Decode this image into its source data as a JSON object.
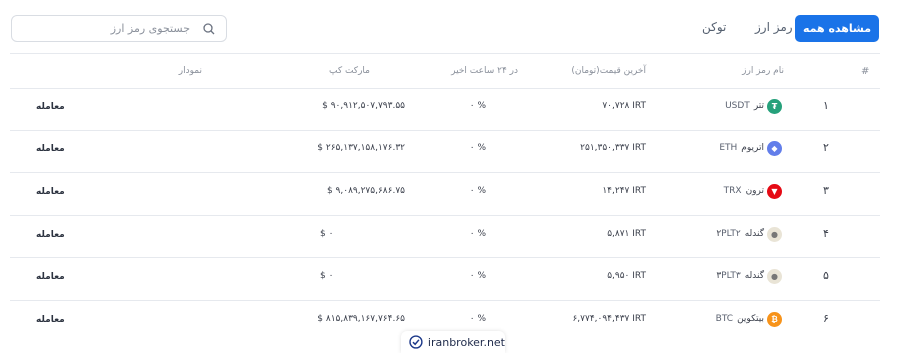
{
  "search": {
    "placeholder": "جستجوی رمز ارز"
  },
  "tabs": {
    "all": "مشاهده همه",
    "crypto": "رمز ارز",
    "token": "توکن"
  },
  "table": {
    "headers": {
      "index": "#",
      "name": "نام رمز ارز",
      "price": "آخرین قیمت(تومان)",
      "change": "در ۲۴ ساعت اخیر",
      "market_cap": "مارکت کپ",
      "chart": "نمودار"
    },
    "rows": [
      {
        "index": "۱",
        "name": "تتر",
        "symbol": "USDT",
        "icon_color": "#26a17b",
        "icon": "tether-icon",
        "price": "۷۰,۷۲۸ IRT",
        "change": "۰ %",
        "market_cap": "$ ۹۰,۹۱۲,۵۰۷,۷۹۳.۵۵",
        "action": "معامله"
      },
      {
        "index": "۲",
        "name": "اتریوم",
        "symbol": "ETH",
        "icon_color": "#627eea",
        "icon": "ethereum-icon",
        "price": "۲۵۱,۳۵۰,۳۳۷ IRT",
        "change": "۰ %",
        "market_cap": "$ ۲۶۵,۱۳۷,۱۵۸,۱۷۶.۳۲",
        "action": "معامله"
      },
      {
        "index": "۳",
        "name": "ترون",
        "symbol": "TRX",
        "icon_color": "#e50914",
        "icon": "tron-icon",
        "price": "۱۴,۲۴۷ IRT",
        "change": "۰ %",
        "market_cap": "$ ۹,۰۸۹,۲۷۵,۶۸۶.۷۵",
        "action": "معامله"
      },
      {
        "index": "۴",
        "name": "گندله۲",
        "symbol": "PLT۲",
        "icon_color": "#e9e4d6",
        "icon": "pellet-icon",
        "price": "۵,۸۷۱ IRT",
        "change": "۰ %",
        "market_cap": "$ ۰",
        "action": "معامله"
      },
      {
        "index": "۵",
        "name": "گندله۳",
        "symbol": "PLT۳",
        "icon_color": "#e9e4d6",
        "icon": "pellet-icon",
        "price": "۵,۹۵۰ IRT",
        "change": "۰ %",
        "market_cap": "$ ۰",
        "action": "معامله"
      },
      {
        "index": "۶",
        "name": "بیتکوین",
        "symbol": "BTC",
        "icon_color": "#f7931a",
        "icon": "bitcoin-icon",
        "price": "۶,۷۷۴,۰۹۴,۴۳۷ IRT",
        "change": "۰ %",
        "market_cap": "$ ۸۱۵,۸۳۹,۱۶۷,۷۶۴.۶۵",
        "action": "معامله"
      }
    ]
  },
  "watermark": {
    "text": "iranbroker.net"
  }
}
